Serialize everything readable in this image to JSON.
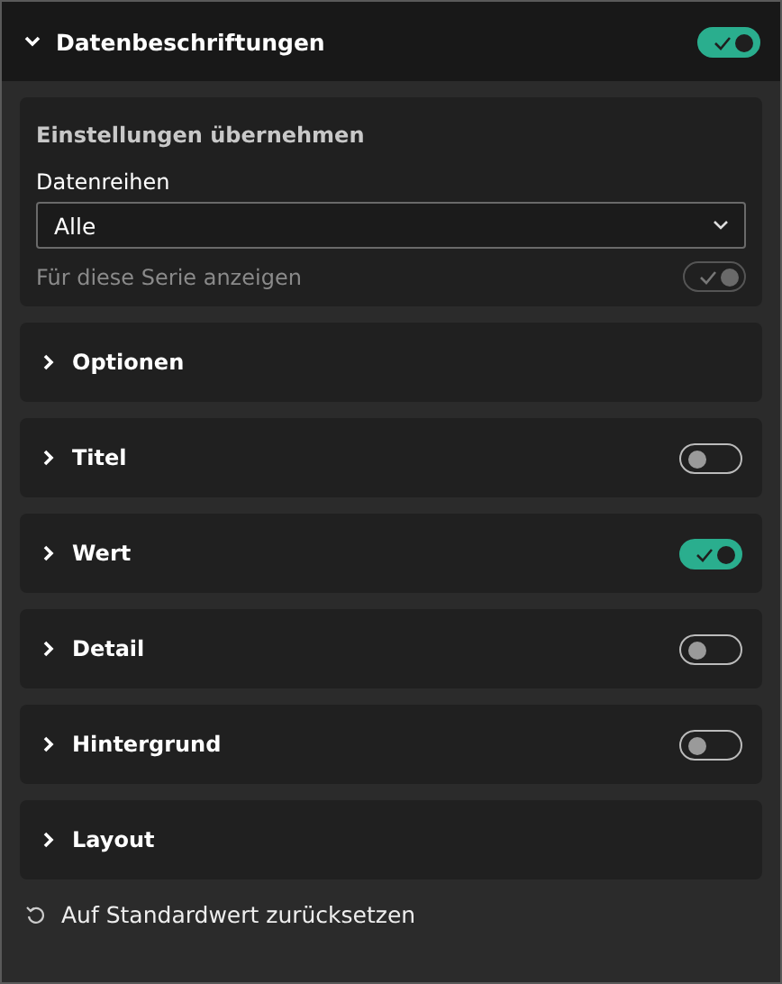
{
  "header": {
    "title": "Datenbeschriftungen",
    "expanded": true,
    "on": true
  },
  "apply_settings": {
    "title": "Einstellungen übernehmen",
    "series_label": "Datenreihen",
    "series_value": "Alle",
    "show_for_series": {
      "label": "Für diese Serie anzeigen",
      "on": true,
      "disabled": true
    }
  },
  "sections": [
    {
      "kind": "plain",
      "title": "Optionen",
      "expanded": false
    },
    {
      "kind": "toggle",
      "title": "Titel",
      "expanded": false,
      "on": false
    },
    {
      "kind": "toggle",
      "title": "Wert",
      "expanded": false,
      "on": true
    },
    {
      "kind": "toggle",
      "title": "Detail",
      "expanded": false,
      "on": false
    },
    {
      "kind": "toggle",
      "title": "Hintergrund",
      "expanded": false,
      "on": false
    },
    {
      "kind": "plain",
      "title": "Layout",
      "expanded": false
    }
  ],
  "reset": {
    "label": "Auf Standardwert zurücksetzen"
  }
}
